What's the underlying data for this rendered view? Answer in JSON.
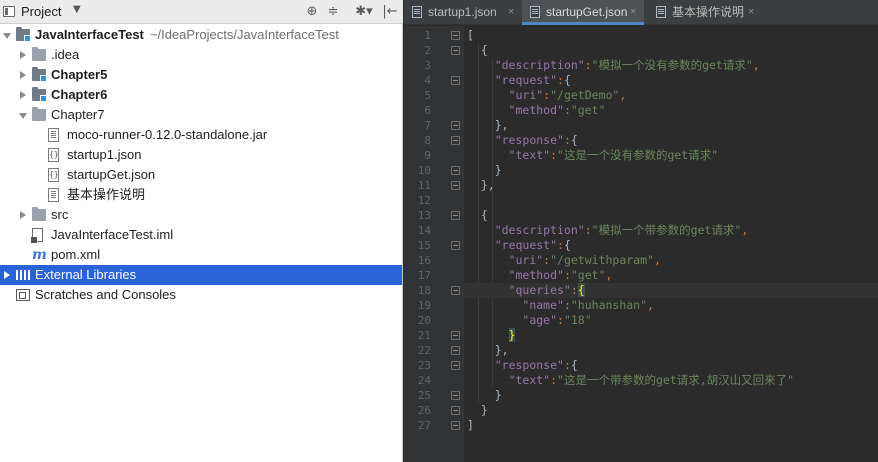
{
  "panel": {
    "title": "Project",
    "tools": [
      "⊕",
      "≑",
      "✱▾",
      "|←"
    ]
  },
  "tree": [
    {
      "label": "JavaInterfaceTest",
      "sub": "~/IdeaProjects/JavaInterfaceTest",
      "bold": true,
      "icon": "module-folder-icon",
      "arrow": "down",
      "indent": 0
    },
    {
      "label": ".idea",
      "icon": "folder-icon",
      "arrow": "right",
      "indent": 1
    },
    {
      "label": "Chapter5",
      "bold": true,
      "icon": "module-folder-icon",
      "arrow": "right",
      "indent": 1
    },
    {
      "label": "Chapter6",
      "bold": true,
      "icon": "module-folder-icon",
      "arrow": "right",
      "indent": 1
    },
    {
      "label": "Chapter7",
      "icon": "folder-icon",
      "arrow": "down",
      "indent": 1
    },
    {
      "label": "moco-runner-0.12.0-standalone.jar",
      "icon": "jar-file-icon",
      "arrow": "none",
      "indent": 2
    },
    {
      "label": "startup1.json",
      "icon": "json-file-icon",
      "arrow": "none",
      "indent": 2
    },
    {
      "label": "startupGet.json",
      "icon": "json-file-icon",
      "arrow": "none",
      "indent": 2
    },
    {
      "label": "基本操作说明",
      "icon": "text-file-icon",
      "arrow": "none",
      "indent": 2
    },
    {
      "label": "src",
      "icon": "folder-icon",
      "arrow": "right",
      "indent": 1
    },
    {
      "label": "JavaInterfaceTest.iml",
      "icon": "iml-file-icon",
      "arrow": "none",
      "indent": 1
    },
    {
      "label": "pom.xml",
      "icon": "maven-icon",
      "arrow": "none",
      "indent": 1
    },
    {
      "label": "External Libraries",
      "icon": "libraries-icon",
      "arrow": "right",
      "indent": 0,
      "selected": true
    },
    {
      "label": "Scratches and Consoles",
      "icon": "scratches-icon",
      "arrow": "none",
      "indent": 0
    }
  ],
  "tabs": [
    {
      "label": "startup1.json",
      "close": "×",
      "active": false
    },
    {
      "label": "startupGet.json",
      "close": "×",
      "active": true
    },
    {
      "label": "基本操作说明",
      "close": "×",
      "active": false
    }
  ],
  "code_lines": [
    [
      {
        "t": "[",
        "c": "b"
      }
    ],
    [
      {
        "t": "  {",
        "c": "b"
      }
    ],
    [
      {
        "t": "    "
      },
      {
        "t": "\"description\"",
        "c": "k"
      },
      {
        "t": ":",
        "c": "p"
      },
      {
        "t": "\"模拟一个没有参数的get请求\"",
        "c": "s"
      },
      {
        "t": ",",
        "c": "p"
      }
    ],
    [
      {
        "t": "    "
      },
      {
        "t": "\"request\"",
        "c": "k"
      },
      {
        "t": ":",
        "c": "p"
      },
      {
        "t": "{",
        "c": "b"
      }
    ],
    [
      {
        "t": "      "
      },
      {
        "t": "\"uri\"",
        "c": "k"
      },
      {
        "t": ":",
        "c": "p"
      },
      {
        "t": "\"/getDemo\"",
        "c": "s"
      },
      {
        "t": ",",
        "c": "p"
      }
    ],
    [
      {
        "t": "      "
      },
      {
        "t": "\"method\"",
        "c": "k"
      },
      {
        "t": ":",
        "c": "p"
      },
      {
        "t": "\"get\"",
        "c": "s"
      }
    ],
    [
      {
        "t": "    "
      },
      {
        "t": "},",
        "c": "b"
      }
    ],
    [
      {
        "t": "    "
      },
      {
        "t": "\"response\"",
        "c": "k"
      },
      {
        "t": ":",
        "c": "p"
      },
      {
        "t": "{",
        "c": "b"
      }
    ],
    [
      {
        "t": "      "
      },
      {
        "t": "\"text\"",
        "c": "k"
      },
      {
        "t": ":",
        "c": "p"
      },
      {
        "t": "\"这是一个没有参数的get请求\"",
        "c": "s"
      }
    ],
    [
      {
        "t": "    "
      },
      {
        "t": "}",
        "c": "b"
      }
    ],
    [
      {
        "t": "  "
      },
      {
        "t": "},",
        "c": "b"
      }
    ],
    [
      {
        "t": ""
      }
    ],
    [
      {
        "t": "  {",
        "c": "b"
      }
    ],
    [
      {
        "t": "    "
      },
      {
        "t": "\"description\"",
        "c": "k"
      },
      {
        "t": ":",
        "c": "p"
      },
      {
        "t": "\"模拟一个带参数的get请求\"",
        "c": "s"
      },
      {
        "t": ",",
        "c": "p"
      }
    ],
    [
      {
        "t": "    "
      },
      {
        "t": "\"request\"",
        "c": "k"
      },
      {
        "t": ":",
        "c": "p"
      },
      {
        "t": "{",
        "c": "b"
      }
    ],
    [
      {
        "t": "      "
      },
      {
        "t": "\"uri\"",
        "c": "k"
      },
      {
        "t": ":",
        "c": "p"
      },
      {
        "t": "\"/getwithparam\"",
        "c": "s"
      },
      {
        "t": ",",
        "c": "p"
      }
    ],
    [
      {
        "t": "      "
      },
      {
        "t": "\"method\"",
        "c": "k"
      },
      {
        "t": ":",
        "c": "p"
      },
      {
        "t": "\"get\"",
        "c": "s"
      },
      {
        "t": ",",
        "c": "p"
      }
    ],
    [
      {
        "t": "      "
      },
      {
        "t": "\"queries\"",
        "c": "k"
      },
      {
        "t": ":",
        "c": "p"
      },
      {
        "t": "{",
        "c": "bm"
      }
    ],
    [
      {
        "t": "        "
      },
      {
        "t": "\"name\"",
        "c": "k"
      },
      {
        "t": ":",
        "c": "p"
      },
      {
        "t": "\"huhanshan\"",
        "c": "s"
      },
      {
        "t": ",",
        "c": "p"
      }
    ],
    [
      {
        "t": "        "
      },
      {
        "t": "\"age\"",
        "c": "k"
      },
      {
        "t": ":",
        "c": "p"
      },
      {
        "t": "\"18\"",
        "c": "s"
      }
    ],
    [
      {
        "t": "      "
      },
      {
        "t": "}",
        "c": "bm"
      }
    ],
    [
      {
        "t": "    "
      },
      {
        "t": "},",
        "c": "b"
      }
    ],
    [
      {
        "t": "    "
      },
      {
        "t": "\"response\"",
        "c": "k"
      },
      {
        "t": ":",
        "c": "p"
      },
      {
        "t": "{",
        "c": "b"
      }
    ],
    [
      {
        "t": "      "
      },
      {
        "t": "\"text\"",
        "c": "k"
      },
      {
        "t": ":",
        "c": "p"
      },
      {
        "t": "\"这是一个带参数的get请求,胡汉山又回来了\"",
        "c": "s"
      }
    ],
    [
      {
        "t": "    "
      },
      {
        "t": "}",
        "c": "b"
      }
    ],
    [
      {
        "t": "  "
      },
      {
        "t": "}",
        "c": "b"
      }
    ],
    [
      {
        "t": "]",
        "c": "b"
      }
    ]
  ],
  "line_numbers": [
    "1",
    "2",
    "3",
    "4",
    "5",
    "6",
    "7",
    "8",
    "9",
    "10",
    "11",
    "12",
    "13",
    "14",
    "15",
    "16",
    "17",
    "18",
    "19",
    "20",
    "21",
    "22",
    "23",
    "24",
    "25",
    "26",
    "27"
  ],
  "highlight_line": 18,
  "fold_lines": [
    1,
    2,
    4,
    7,
    8,
    10,
    11,
    13,
    15,
    18,
    21,
    22,
    23,
    25,
    26,
    27
  ]
}
